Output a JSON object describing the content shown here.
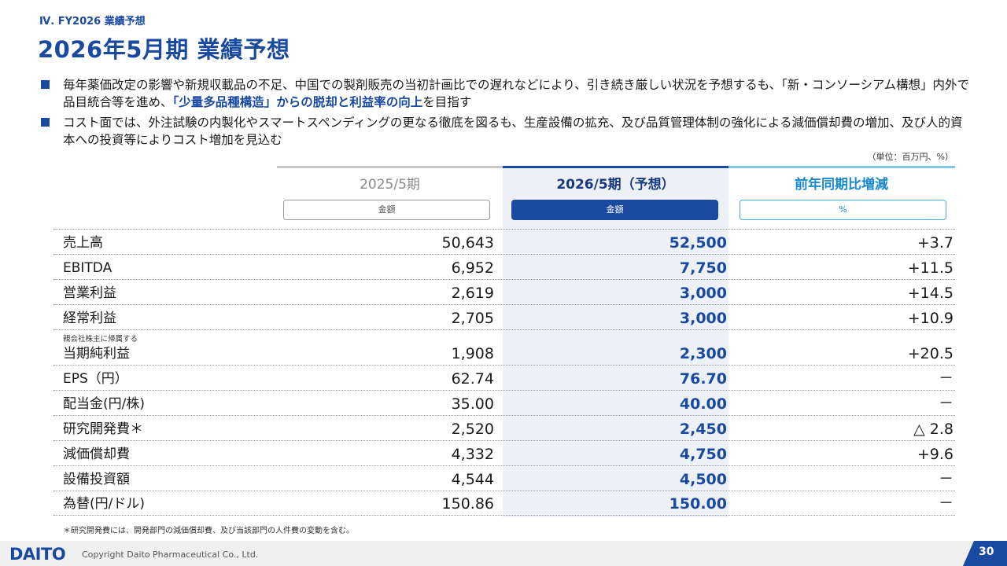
{
  "header": {
    "section_label": "Ⅳ. FY2026 業績予想",
    "title": "2026年5月期 業績予想"
  },
  "bullets": {
    "b1_pre": "毎年薬価改定の影響や新規収載品の不足、中国での製剤販売の当初計画比での遅れなどにより、引き続き厳しい状況を予想するも、「新・コンソーシアム構想」内外で品目統合等を進め、",
    "b1_highlight": "「少量多品種構造」からの脱却と利益率の向上",
    "b1_post": "を目指す",
    "b2": "コスト面では、外注試験の内製化やスマートスペンディングの更なる徹底を図るも、生産設備の拡充、及び品質管理体制の強化による減価償却費の増加、及び人的資本への投資等によりコスト増加を見込む"
  },
  "unit_note": "（単位：百万円、%）",
  "columns": {
    "prev": {
      "header": "2025/5期",
      "pill": "金額"
    },
    "forecast": {
      "header": "2026/5期（予想）",
      "pill": "金額"
    },
    "yoy": {
      "header": "前年同期比増減",
      "pill": "%"
    }
  },
  "rows": [
    {
      "label": "売上高",
      "prev": "50,643",
      "forecast": "52,500",
      "yoy": "+3.7"
    },
    {
      "label": "EBITDA",
      "prev": "6,952",
      "forecast": "7,750",
      "yoy": "+11.5"
    },
    {
      "label": "営業利益",
      "prev": "2,619",
      "forecast": "3,000",
      "yoy": "+14.5"
    },
    {
      "label": "経常利益",
      "prev": "2,705",
      "forecast": "3,000",
      "yoy": "+10.9"
    },
    {
      "sublabel": "親会社株主に帰属する",
      "label": "当期純利益",
      "prev": "1,908",
      "forecast": "2,300",
      "yoy": "+20.5"
    },
    {
      "label": "EPS（円）",
      "prev": "62.74",
      "forecast": "76.70",
      "yoy": "－"
    },
    {
      "label": "配当金(円/株)",
      "prev": "35.00",
      "forecast": "40.00",
      "yoy": "－"
    },
    {
      "label": "研究開発費＊",
      "prev": "2,520",
      "forecast": "2,450",
      "yoy": "△ 2.8"
    },
    {
      "label": "減価償却費",
      "prev": "4,332",
      "forecast": "4,750",
      "yoy": "+9.6"
    },
    {
      "label": "設備投資額",
      "prev": "4,544",
      "forecast": "4,500",
      "yoy": "－"
    },
    {
      "label": "為替(円/ドル)",
      "prev": "150.86",
      "forecast": "150.00",
      "yoy": "－"
    }
  ],
  "footnote": "＊研究開発費には、開発部門の減価償却費、及び当該部門の人件費の変動を含む。",
  "footer": {
    "logo": "DAITO",
    "copyright": "Copyright  Daito Pharmaceutical Co., Ltd.",
    "page_number": "30"
  }
}
